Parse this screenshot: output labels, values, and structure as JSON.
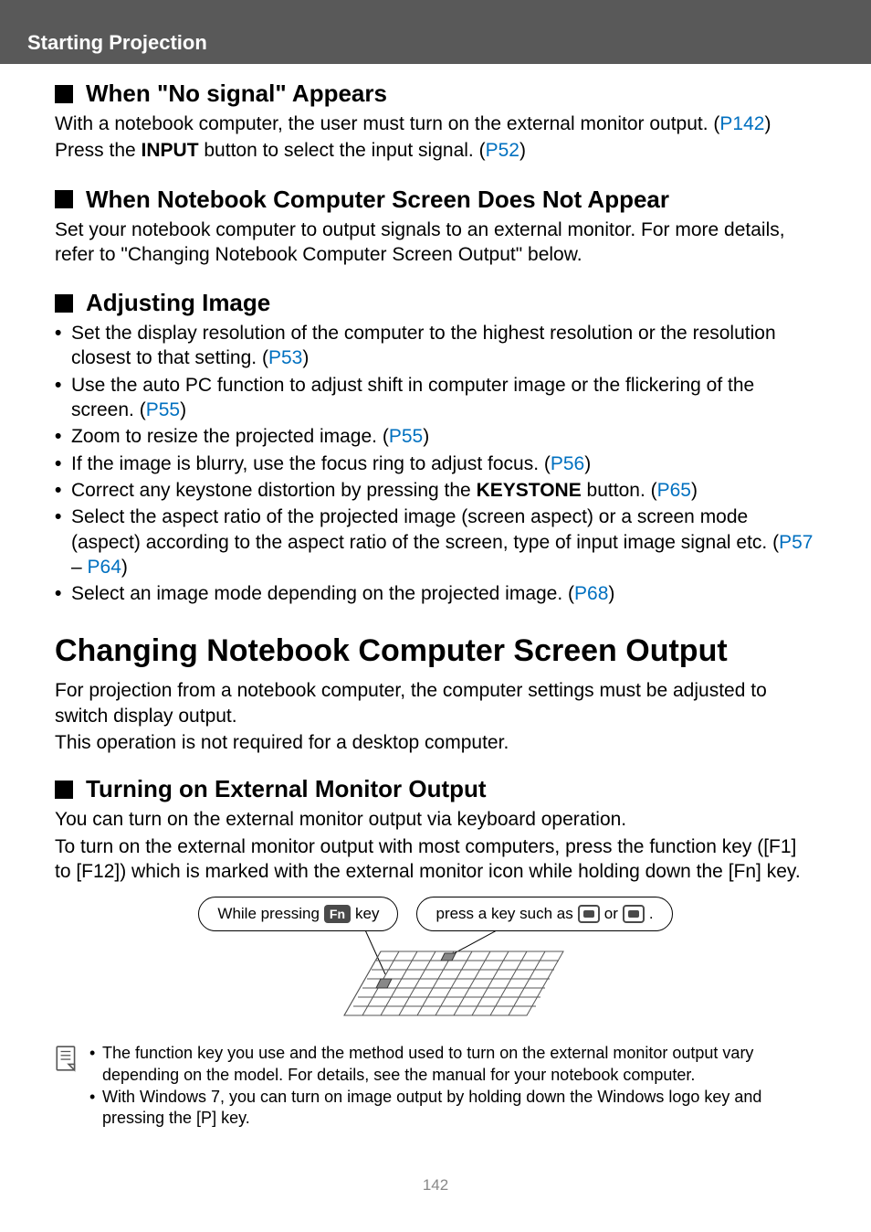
{
  "header": {
    "section_title": "Starting Projection"
  },
  "sec1": {
    "heading": "When \"No signal\" Appears",
    "p1a": "With a notebook computer, the user must turn on the external monitor output. (",
    "p1_link": "P142",
    "p1b": ")",
    "p2a": "Press the ",
    "p2_bold": "INPUT",
    "p2b": " button to select the input signal. (",
    "p2_link": "P52",
    "p2c": ")"
  },
  "sec2": {
    "heading": "When Notebook Computer Screen Does Not Appear",
    "p1": "Set your notebook computer to output signals to an external monitor. For more details, refer to \"Changing Notebook Computer Screen Output\" below."
  },
  "sec3": {
    "heading": "Adjusting Image",
    "b1a": "Set the display resolution of the computer to the highest resolution or the resolution closest to that setting. (",
    "b1_link": "P53",
    "b1b": ")",
    "b2a": "Use the auto PC function to adjust shift in computer image or the flickering of the screen. (",
    "b2_link": "P55",
    "b2b": ")",
    "b3a": "Zoom to resize the projected image. (",
    "b3_link": "P55",
    "b3b": ")",
    "b4a": "If the image is blurry, use the focus ring to adjust focus. (",
    "b4_link": "P56",
    "b4b": ")",
    "b5a": "Correct any keystone distortion by pressing the ",
    "b5_bold": "KEYSTONE",
    "b5b": " button. (",
    "b5_link": "P65",
    "b5c": ")",
    "b6a": "Select the aspect ratio of the projected image (screen aspect) or a screen mode (aspect) according to the aspect ratio of the screen, type of input image signal etc. (",
    "b6_link1": "P57",
    "b6b": " – ",
    "b6_link2": "P64",
    "b6c": ")",
    "b7a": "Select an image mode depending on the projected image. (",
    "b7_link": "P68",
    "b7b": ")"
  },
  "big": {
    "heading": "Changing Notebook Computer Screen Output",
    "p1": "For projection from a notebook computer, the computer settings must be adjusted to switch display output.",
    "p2": "This operation is not required for a desktop computer."
  },
  "sec4": {
    "heading": "Turning on External Monitor Output",
    "p1": "You can turn on the external monitor output via keyboard operation.",
    "p2": "To turn on the external monitor output with most computers, press the function key ([F1] to [F12]) which is marked with the external monitor icon while holding down the [Fn] key."
  },
  "diagram": {
    "bubble1a": "While pressing",
    "bubble1_key": "Fn",
    "bubble1b": "key",
    "bubble2a": "press a key such as",
    "bubble2b": "or",
    "bubble2c": "."
  },
  "notes": {
    "n1": "The function key you use and the method used to turn on the external monitor output vary depending on the model. For details, see the manual for your notebook computer.",
    "n2": "With Windows 7, you can turn on image output by holding down the Windows logo key and pressing the [P] key."
  },
  "page_number": "142"
}
